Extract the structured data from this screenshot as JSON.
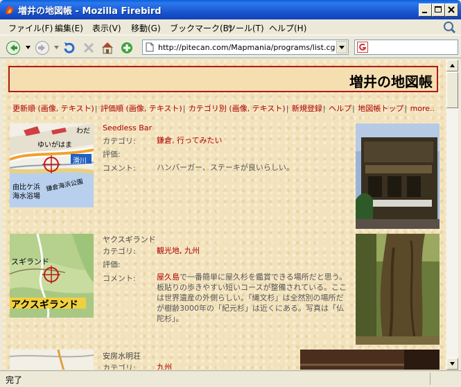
{
  "window": {
    "title": "増井の地図帳 - Mozilla Firebird"
  },
  "menu": [
    "ファイル(F)",
    "編集(E)",
    "表示(V)",
    "移動(G)",
    "ブックマーク(B)",
    "ツール(T)",
    "ヘルプ(H)"
  ],
  "toolbar": {
    "url": "http://pitecan.com/Mapmania/programs/list.cgi?s",
    "search_value": ""
  },
  "page": {
    "title": "増井の地図帳",
    "nav": [
      "更新順 (画像, テキスト)",
      "評価順 (画像, テキスト)",
      "カテゴリ別 (画像, テキスト)",
      "新規登録",
      "ヘルプ",
      "地図帳トップ",
      "more.."
    ],
    "labels": {
      "category": "カテゴリ:",
      "rating": "評価:",
      "comment": "コメント:"
    },
    "entries": [
      {
        "name": "Seedless Bar",
        "category": "鎌倉, 行ってみたい",
        "rating": "",
        "comment": "ハンバーガー、ステーキが良いらしい。",
        "map_labels": [
          "わだ",
          "ゆいがはま",
          "滑川",
          "由比ケ浜",
          "海水浴場",
          "鎌倉海浜公園"
        ]
      },
      {
        "name": "ヤクスギランド",
        "category": "観光地, 九州",
        "rating": "",
        "comment_red": "屋久島",
        "comment": "で一番簡単に屋久杉を鑑賞できる場所だと思う。板貼りの歩きやすい短いコースが整備されている。ここは世界遺産の外側らしい。「縄文杉」は全然別の場所だが樹齢3000年の「紀元杉」は近くにある。写真は「仏陀杉」。",
        "map_labels": [
          "スギランド",
          "アクスギランド"
        ]
      },
      {
        "name": "安房水明荘",
        "category": "九州",
        "map_labels": []
      }
    ]
  },
  "status": {
    "text": "完了"
  },
  "colors": {
    "link": "#b00000",
    "header_border": "#b01818",
    "page_bg": "#f3e3bc",
    "titlebar": "#1b58d0"
  }
}
